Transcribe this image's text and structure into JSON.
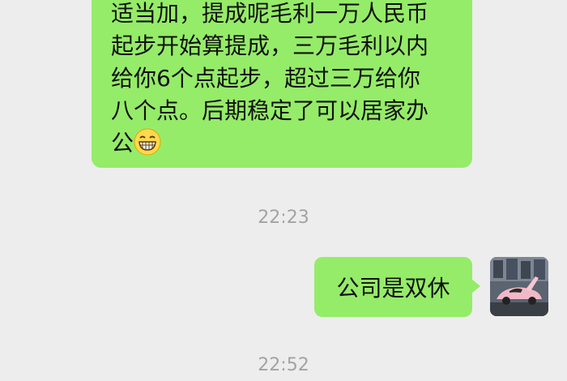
{
  "chat": {
    "received_message": {
      "lines": [
        "适当加，提成呢毛利一万人民币",
        "起步开始算提成，三万毛利以内",
        "给你6个点起步，超过三万给你",
        "八个点。后期稳定了可以居家办",
        "公"
      ],
      "emoji": "grinning-face-icon"
    },
    "timestamps": [
      "22:23",
      "22:52"
    ],
    "sent_message": {
      "text": "公司是双休"
    },
    "avatar": {
      "label": "pink sports car avatar"
    },
    "colors": {
      "bubble": "#95ec69",
      "background": "#ededed",
      "timestamp": "#a3a3a3"
    }
  }
}
